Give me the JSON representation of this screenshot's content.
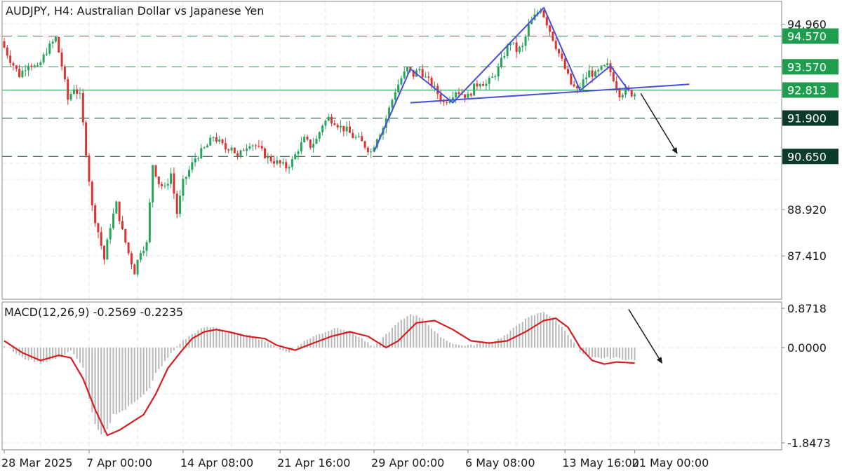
{
  "chart_data": [
    {
      "type": "candlestick",
      "title": "AUDJPY, H4:  Australian Dollar vs Japanese Yen",
      "x_tick_labels": [
        "28 Mar 2025",
        "7 Apr 00:00",
        "14 Apr 08:00",
        "21 Apr 16:00",
        "29 Apr 00:00",
        "6 May 08:00",
        "13 May 16:00",
        "21 May 00:00"
      ],
      "y_tick_labels": [
        "94.960",
        "93.570",
        "91.900",
        "90.650",
        "88.920",
        "87.410"
      ],
      "ylim": [
        86.0,
        95.7
      ],
      "grid": true,
      "price_path": [
        {
          "i": 0,
          "p": 94.4
        },
        {
          "i": 3,
          "p": 93.8
        },
        {
          "i": 6,
          "p": 93.3
        },
        {
          "i": 9,
          "p": 93.7
        },
        {
          "i": 12,
          "p": 93.5
        },
        {
          "i": 15,
          "p": 94.1
        },
        {
          "i": 18,
          "p": 94.5
        },
        {
          "i": 20,
          "p": 93.6
        },
        {
          "i": 22,
          "p": 92.5
        },
        {
          "i": 24,
          "p": 92.9
        },
        {
          "i": 26,
          "p": 92.6
        },
        {
          "i": 28,
          "p": 90.8
        },
        {
          "i": 30,
          "p": 89.0
        },
        {
          "i": 32,
          "p": 88.2
        },
        {
          "i": 34,
          "p": 87.3
        },
        {
          "i": 36,
          "p": 88.4
        },
        {
          "i": 38,
          "p": 89.1
        },
        {
          "i": 40,
          "p": 88.2
        },
        {
          "i": 42,
          "p": 87.5
        },
        {
          "i": 44,
          "p": 86.9
        },
        {
          "i": 46,
          "p": 87.6
        },
        {
          "i": 48,
          "p": 87.8
        },
        {
          "i": 50,
          "p": 90.4
        },
        {
          "i": 52,
          "p": 89.8
        },
        {
          "i": 54,
          "p": 89.6
        },
        {
          "i": 56,
          "p": 90.1
        },
        {
          "i": 58,
          "p": 88.8
        },
        {
          "i": 60,
          "p": 89.8
        },
        {
          "i": 62,
          "p": 90.2
        },
        {
          "i": 64,
          "p": 90.6
        },
        {
          "i": 66,
          "p": 90.8
        },
        {
          "i": 68,
          "p": 91.0
        },
        {
          "i": 70,
          "p": 91.3
        },
        {
          "i": 72,
          "p": 91.1
        },
        {
          "i": 74,
          "p": 90.9
        },
        {
          "i": 76,
          "p": 91.0
        },
        {
          "i": 78,
          "p": 90.6
        },
        {
          "i": 80,
          "p": 90.9
        },
        {
          "i": 82,
          "p": 91.1
        },
        {
          "i": 84,
          "p": 91.0
        },
        {
          "i": 86,
          "p": 90.8
        },
        {
          "i": 88,
          "p": 90.6
        },
        {
          "i": 90,
          "p": 90.5
        },
        {
          "i": 92,
          "p": 90.4
        },
        {
          "i": 94,
          "p": 90.3
        },
        {
          "i": 96,
          "p": 90.5
        },
        {
          "i": 98,
          "p": 90.9
        },
        {
          "i": 100,
          "p": 91.2
        },
        {
          "i": 102,
          "p": 91.0
        },
        {
          "i": 104,
          "p": 91.2
        },
        {
          "i": 106,
          "p": 91.7
        },
        {
          "i": 108,
          "p": 91.9
        },
        {
          "i": 110,
          "p": 91.8
        },
        {
          "i": 112,
          "p": 91.6
        },
        {
          "i": 114,
          "p": 91.5
        },
        {
          "i": 116,
          "p": 91.3
        },
        {
          "i": 118,
          "p": 91.2
        },
        {
          "i": 120,
          "p": 91.0
        },
        {
          "i": 122,
          "p": 90.8
        },
        {
          "i": 124,
          "p": 91.3
        },
        {
          "i": 126,
          "p": 91.6
        },
        {
          "i": 128,
          "p": 92.2
        },
        {
          "i": 130,
          "p": 92.8
        },
        {
          "i": 132,
          "p": 93.2
        },
        {
          "i": 134,
          "p": 93.5
        },
        {
          "i": 136,
          "p": 93.3
        },
        {
          "i": 138,
          "p": 93.5
        },
        {
          "i": 140,
          "p": 93.2
        },
        {
          "i": 142,
          "p": 93.0
        },
        {
          "i": 144,
          "p": 92.7
        },
        {
          "i": 146,
          "p": 92.4
        },
        {
          "i": 148,
          "p": 92.6
        },
        {
          "i": 150,
          "p": 92.8
        },
        {
          "i": 152,
          "p": 92.7
        },
        {
          "i": 154,
          "p": 92.6
        },
        {
          "i": 156,
          "p": 92.9
        },
        {
          "i": 158,
          "p": 93.1
        },
        {
          "i": 160,
          "p": 93.0
        },
        {
          "i": 162,
          "p": 93.2
        },
        {
          "i": 164,
          "p": 93.5
        },
        {
          "i": 166,
          "p": 94.0
        },
        {
          "i": 168,
          "p": 94.4
        },
        {
          "i": 170,
          "p": 94.1
        },
        {
          "i": 172,
          "p": 94.2
        },
        {
          "i": 174,
          "p": 94.9
        },
        {
          "i": 176,
          "p": 95.2
        },
        {
          "i": 178,
          "p": 95.5
        },
        {
          "i": 180,
          "p": 95.0
        },
        {
          "i": 182,
          "p": 94.5
        },
        {
          "i": 184,
          "p": 94.0
        },
        {
          "i": 186,
          "p": 93.5
        },
        {
          "i": 188,
          "p": 93.0
        },
        {
          "i": 190,
          "p": 92.8
        },
        {
          "i": 192,
          "p": 93.1
        },
        {
          "i": 194,
          "p": 93.4
        },
        {
          "i": 196,
          "p": 93.3
        },
        {
          "i": 198,
          "p": 93.5
        },
        {
          "i": 200,
          "p": 93.6
        },
        {
          "i": 202,
          "p": 93.2
        },
        {
          "i": 204,
          "p": 92.7
        },
        {
          "i": 206,
          "p": 92.8
        },
        {
          "i": 208,
          "p": 92.7
        }
      ],
      "series": [
        {
          "name": "head-and-shoulders",
          "color": "#4a4fd8",
          "points": [
            {
              "i": 122,
              "p": 90.8
            },
            {
              "i": 134,
              "p": 93.5
            },
            {
              "i": 148,
              "p": 92.4
            },
            {
              "i": 178,
              "p": 95.5
            },
            {
              "i": 190,
              "p": 92.8
            },
            {
              "i": 200,
              "p": 93.6
            },
            {
              "i": 206,
              "p": 92.8
            }
          ]
        },
        {
          "name": "neckline",
          "color": "#4a4fd8",
          "points": [
            {
              "i": 134,
              "p": 92.4
            },
            {
              "i": 226,
              "p": 93.0
            }
          ]
        },
        {
          "name": "forecast-arrow",
          "color": "#1a1a1a",
          "points": [
            {
              "i": 210,
              "p": 92.7
            },
            {
              "i": 222,
              "p": 90.75
            }
          ]
        }
      ],
      "horizontal_levels": [
        {
          "label": "94.570",
          "value": 94.57,
          "style": "dashed",
          "color": "#1e9d4f"
        },
        {
          "label": "93.570",
          "value": 93.57,
          "style": "dashed",
          "color": "#1e9d4f"
        },
        {
          "label": "92.813",
          "value": 92.813,
          "style": "solid",
          "color": "#1e9d4f"
        },
        {
          "label": "91.900",
          "value": 91.9,
          "style": "dashed",
          "color": "#0c3b2e"
        },
        {
          "label": "90.650",
          "value": 90.65,
          "style": "dashed",
          "color": "#0c3b2e"
        }
      ],
      "candle_colors": {
        "up": "#26a65b",
        "down": "#e03131"
      }
    },
    {
      "type": "bar",
      "title": "MACD(12,26,9) -0.2569 -0.2235",
      "y_tick_labels": [
        "0.8718",
        "0.0000",
        "-1.8473"
      ],
      "ylim": [
        -1.8473,
        0.8718
      ],
      "histogram_path": [
        {
          "i": 0,
          "v": 0.05
        },
        {
          "i": 6,
          "v": -0.2
        },
        {
          "i": 12,
          "v": -0.3
        },
        {
          "i": 18,
          "v": -0.2
        },
        {
          "i": 22,
          "v": -0.05
        },
        {
          "i": 26,
          "v": -0.4
        },
        {
          "i": 28,
          "v": -1.0
        },
        {
          "i": 30,
          "v": -1.5
        },
        {
          "i": 32,
          "v": -1.7
        },
        {
          "i": 34,
          "v": -1.6
        },
        {
          "i": 36,
          "v": -1.3
        },
        {
          "i": 40,
          "v": -1.2
        },
        {
          "i": 44,
          "v": -1.0
        },
        {
          "i": 48,
          "v": -0.8
        },
        {
          "i": 50,
          "v": -0.5
        },
        {
          "i": 54,
          "v": -0.2
        },
        {
          "i": 58,
          "v": 0.1
        },
        {
          "i": 62,
          "v": 0.3
        },
        {
          "i": 66,
          "v": 0.45
        },
        {
          "i": 70,
          "v": 0.45
        },
        {
          "i": 74,
          "v": 0.35
        },
        {
          "i": 78,
          "v": 0.3
        },
        {
          "i": 82,
          "v": 0.25
        },
        {
          "i": 86,
          "v": 0.15
        },
        {
          "i": 90,
          "v": 0.0
        },
        {
          "i": 94,
          "v": -0.1
        },
        {
          "i": 98,
          "v": 0.1
        },
        {
          "i": 102,
          "v": 0.25
        },
        {
          "i": 106,
          "v": 0.35
        },
        {
          "i": 110,
          "v": 0.45
        },
        {
          "i": 114,
          "v": 0.35
        },
        {
          "i": 118,
          "v": 0.2
        },
        {
          "i": 122,
          "v": 0.0
        },
        {
          "i": 126,
          "v": 0.3
        },
        {
          "i": 130,
          "v": 0.55
        },
        {
          "i": 134,
          "v": 0.75
        },
        {
          "i": 138,
          "v": 0.65
        },
        {
          "i": 142,
          "v": 0.35
        },
        {
          "i": 146,
          "v": 0.15
        },
        {
          "i": 150,
          "v": 0.05
        },
        {
          "i": 154,
          "v": 0.05
        },
        {
          "i": 158,
          "v": 0.1
        },
        {
          "i": 162,
          "v": 0.15
        },
        {
          "i": 166,
          "v": 0.3
        },
        {
          "i": 170,
          "v": 0.55
        },
        {
          "i": 174,
          "v": 0.7
        },
        {
          "i": 178,
          "v": 0.8
        },
        {
          "i": 182,
          "v": 0.6
        },
        {
          "i": 186,
          "v": 0.3
        },
        {
          "i": 190,
          "v": -0.1
        },
        {
          "i": 194,
          "v": -0.2
        },
        {
          "i": 198,
          "v": -0.2
        },
        {
          "i": 202,
          "v": -0.2
        },
        {
          "i": 208,
          "v": -0.25
        }
      ],
      "series": [
        {
          "name": "Signal",
          "color": "#d81d1d",
          "points": [
            {
              "i": 0,
              "v": 0.15
            },
            {
              "i": 6,
              "v": -0.1
            },
            {
              "i": 12,
              "v": -0.25
            },
            {
              "i": 18,
              "v": -0.15
            },
            {
              "i": 22,
              "v": -0.2
            },
            {
              "i": 26,
              "v": -0.6
            },
            {
              "i": 30,
              "v": -1.2
            },
            {
              "i": 34,
              "v": -1.7
            },
            {
              "i": 38,
              "v": -1.6
            },
            {
              "i": 42,
              "v": -1.45
            },
            {
              "i": 46,
              "v": -1.3
            },
            {
              "i": 50,
              "v": -0.9
            },
            {
              "i": 54,
              "v": -0.4
            },
            {
              "i": 58,
              "v": -0.1
            },
            {
              "i": 62,
              "v": 0.2
            },
            {
              "i": 66,
              "v": 0.35
            },
            {
              "i": 70,
              "v": 0.4
            },
            {
              "i": 74,
              "v": 0.35
            },
            {
              "i": 80,
              "v": 0.25
            },
            {
              "i": 86,
              "v": 0.2
            },
            {
              "i": 90,
              "v": 0.05
            },
            {
              "i": 96,
              "v": -0.05
            },
            {
              "i": 102,
              "v": 0.1
            },
            {
              "i": 108,
              "v": 0.25
            },
            {
              "i": 114,
              "v": 0.35
            },
            {
              "i": 120,
              "v": 0.25
            },
            {
              "i": 126,
              "v": 0.0
            },
            {
              "i": 130,
              "v": 0.15
            },
            {
              "i": 136,
              "v": 0.55
            },
            {
              "i": 142,
              "v": 0.6
            },
            {
              "i": 148,
              "v": 0.4
            },
            {
              "i": 154,
              "v": 0.15
            },
            {
              "i": 160,
              "v": 0.1
            },
            {
              "i": 166,
              "v": 0.15
            },
            {
              "i": 172,
              "v": 0.35
            },
            {
              "i": 178,
              "v": 0.6
            },
            {
              "i": 182,
              "v": 0.65
            },
            {
              "i": 186,
              "v": 0.45
            },
            {
              "i": 190,
              "v": 0.0
            },
            {
              "i": 194,
              "v": -0.25
            },
            {
              "i": 198,
              "v": -0.32
            },
            {
              "i": 202,
              "v": -0.28
            },
            {
              "i": 208,
              "v": -0.3
            }
          ]
        },
        {
          "name": "forecast-arrow",
          "color": "#1a1a1a",
          "points": [
            {
              "i": 206,
              "v": 0.85
            },
            {
              "i": 217,
              "v": -0.3
            }
          ]
        }
      ],
      "histogram_color": "#b8b8b8"
    }
  ]
}
